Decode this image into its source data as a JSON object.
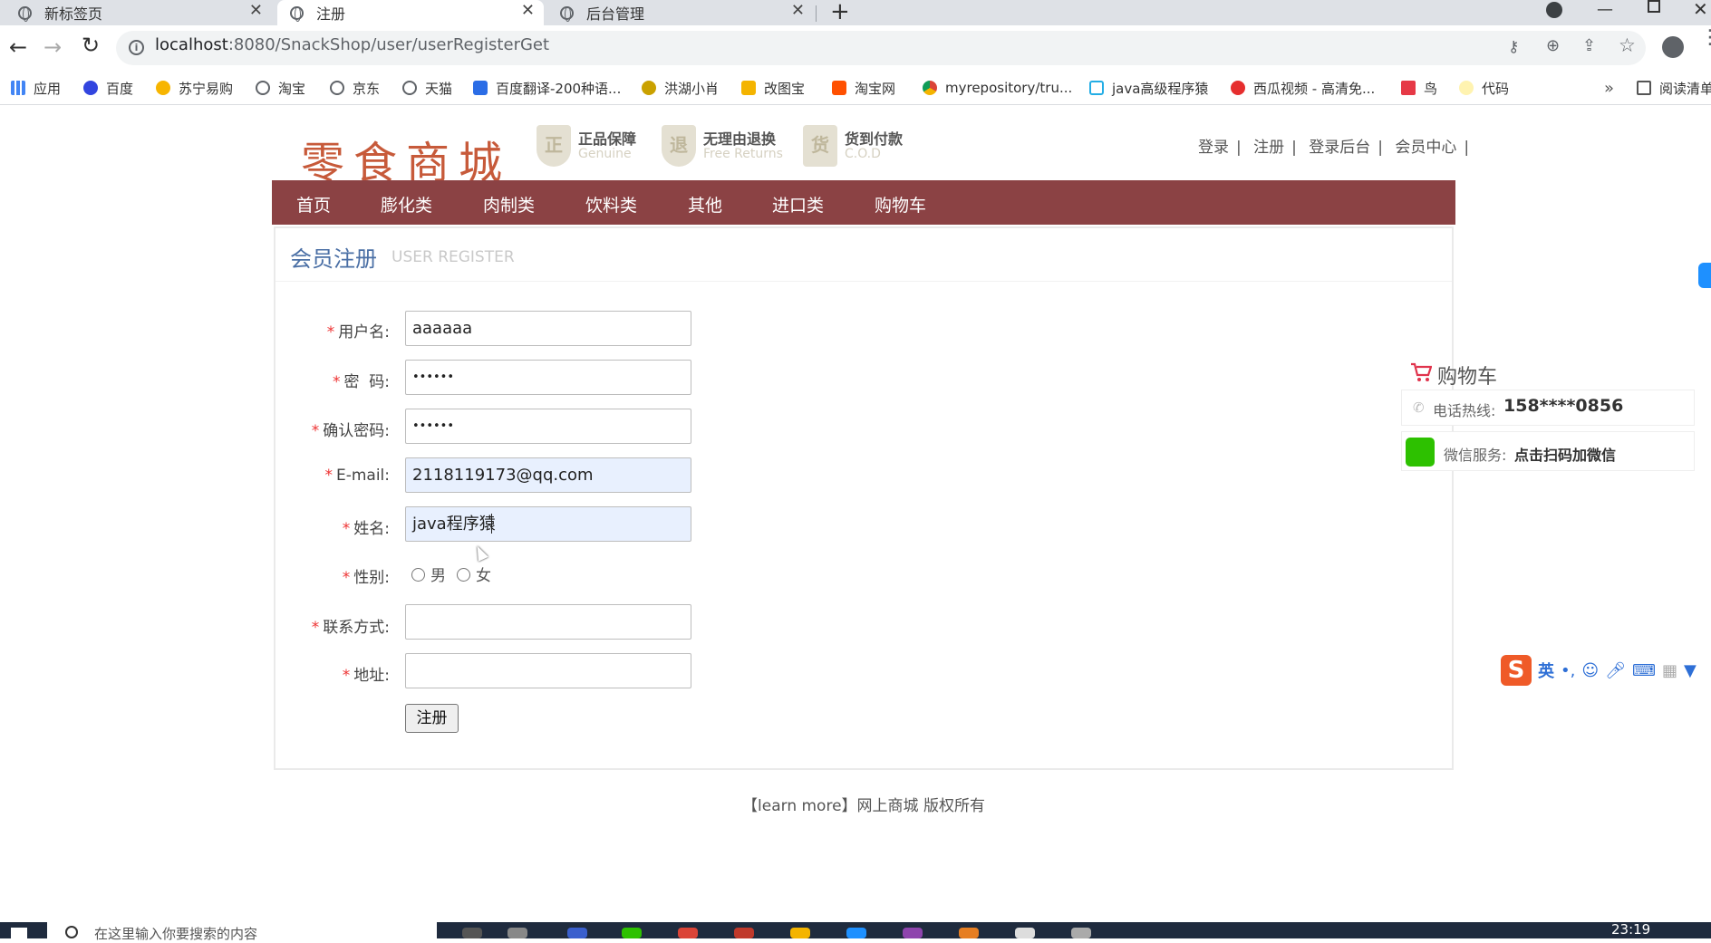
{
  "browser": {
    "tabs": [
      {
        "label": "新标签页",
        "active": false
      },
      {
        "label": "注册",
        "active": true
      },
      {
        "label": "后台管理",
        "active": false
      }
    ],
    "url_host": "localhost",
    "url_path": ":8080/SnackShop/user/userRegisterGet",
    "bookmarks": [
      {
        "label": "应用",
        "icon": "apps-grid-icon",
        "color": "#4285f4"
      },
      {
        "label": "百度",
        "icon": "baidu-paw-icon",
        "color": "#3245df"
      },
      {
        "label": "苏宁易购",
        "icon": "suning-icon",
        "color": "#f7b500"
      },
      {
        "label": "淘宝",
        "icon": "globe-icon",
        "color": "#5f6368"
      },
      {
        "label": "京东",
        "icon": "globe-icon",
        "color": "#5f6368"
      },
      {
        "label": "天猫",
        "icon": "globe-icon",
        "color": "#5f6368"
      },
      {
        "label": "百度翻译-200种语...",
        "icon": "translate-icon",
        "color": "#2b6de6"
      },
      {
        "label": "洪湖小肖",
        "icon": "bird-icon",
        "color": "#caa100"
      },
      {
        "label": "改图宝",
        "icon": "gaitubao-icon",
        "color": "#f4b400"
      },
      {
        "label": "淘宝网",
        "icon": "taobao-icon",
        "color": "#ff5000"
      },
      {
        "label": "myrepository/tru...",
        "icon": "chrome-icon",
        "color": "#db4437"
      },
      {
        "label": "java高级程序猿",
        "icon": "bilibili-icon",
        "color": "#23ade5"
      },
      {
        "label": "西瓜视频 - 高清免...",
        "icon": "xigua-icon",
        "color": "#e62e2e"
      },
      {
        "label": "鸟",
        "icon": "bird-icon",
        "color": "#e63946"
      },
      {
        "label": "代码",
        "icon": "code-icon",
        "color": "#ffd700"
      }
    ],
    "reading_list": "阅读清单"
  },
  "site": {
    "logo_text": "零食商城",
    "promos": [
      {
        "title": "正品保障",
        "sub": "Genuine",
        "glyph": "正"
      },
      {
        "title": "无理由退换",
        "sub": "Free Returns",
        "glyph": "退"
      },
      {
        "title": "货到付款",
        "sub": "C.O.D",
        "glyph": "货"
      }
    ],
    "top_links": [
      "登录",
      "注册",
      "登录后台",
      "会员中心"
    ],
    "sep": "|",
    "nav": [
      "首页",
      "膨化类",
      "肉制类",
      "饮料类",
      "其他",
      "进口类",
      "购物车"
    ],
    "nav_color": "#8b4244"
  },
  "register": {
    "title": "会员注册",
    "subtitle": "USER REGISTER",
    "required_mark": "*",
    "fields": [
      {
        "label": "用户名:",
        "value": "aaaaaa"
      },
      {
        "label": "密  码:",
        "value": "••••••"
      },
      {
        "label": "确认密码:",
        "value": "••••••"
      },
      {
        "label": "E-mail:",
        "value": "2118119173@qq.com"
      },
      {
        "label": "姓名:",
        "value": "java程序猿"
      }
    ],
    "gender_label": "性别:",
    "gender_options": [
      "男",
      "女"
    ],
    "contact_label": "联系方式:",
    "contact_value": "",
    "address_label": "地址:",
    "address_value": "",
    "submit_label": "注册"
  },
  "footer": "【learn more】网上商城 版权所有",
  "side": {
    "cart_label": "购物车",
    "hotline_key": "电话热线:",
    "hotline_value": "158****0856",
    "wechat_key": "微信服务:",
    "wechat_value": "点击扫码加微信"
  },
  "ime": {
    "lang": "英",
    "punct": "•,"
  },
  "taskbar": {
    "search_text": "在这里输入你要搜索的内容",
    "time": "23:19"
  }
}
